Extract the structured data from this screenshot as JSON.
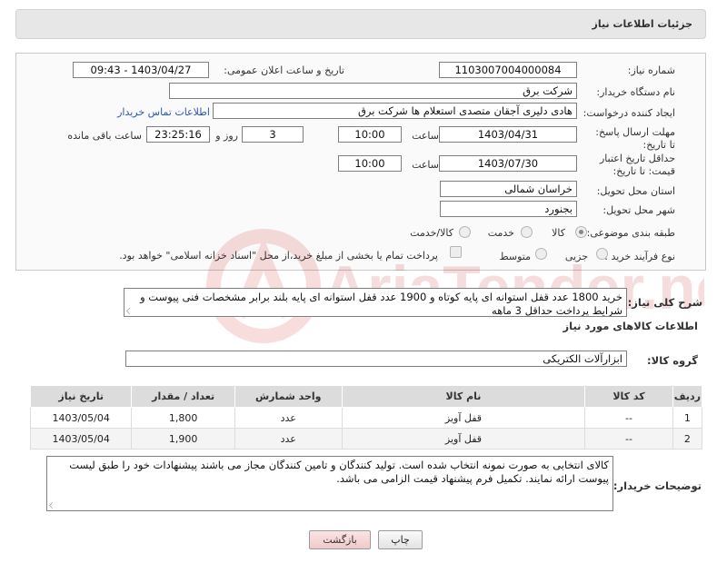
{
  "header": {
    "title": "جزئیات اطلاعات نیاز"
  },
  "form": {
    "need_number_label": "شماره نیاز:",
    "need_number": "1103007004000084",
    "announce_label": "تاریخ و ساعت اعلان عمومی:",
    "announce_value": "1403/04/27 - 09:43",
    "buyer_org_label": "نام دستگاه خریدار:",
    "buyer_org": "شرکت برق",
    "creator_label": "ایجاد کننده درخواست:",
    "creator": "هادی دلیری آجقان متصدی استعلام ها  شرکت برق",
    "contact_link": "اطلاعات تماس خریدار",
    "deadline_label": "مهلت ارسال پاسخ: تا تاریخ:",
    "deadline_date": "1403/04/31",
    "time_label": "ساعت",
    "deadline_time": "10:00",
    "days_value": "3",
    "days_label": "روز و",
    "remaining_time": "23:25:16",
    "remaining_label": "ساعت باقی مانده",
    "validity_label": "حداقل تاریخ اعتبار قیمت: تا تاریخ:",
    "validity_date": "1403/07/30",
    "validity_time": "10:00",
    "province_label": "استان محل تحویل:",
    "province": "خراسان شمالی",
    "city_label": "شهر محل تحویل:",
    "city": "بجنورد",
    "category_label": "طبقه بندی موضوعی:",
    "category_options": [
      "کالا",
      "خدمت",
      "کالا/خدمت"
    ],
    "process_label": "نوع فرآیند خرید :",
    "process_options": [
      "جزیی",
      "متوسط"
    ],
    "payment_note": "پرداخت تمام یا بخشی از مبلغ خرید،از محل \"اسناد خزانه اسلامی\" خواهد بود."
  },
  "description": {
    "label": "شرح کلی نیاز:",
    "text": "خرید 1800 عدد قفل استوانه ای پایه کوتاه و 1900 عدد قفل استوانه ای پایه بلند برابر مشخصات فنی پیوست و شرایط پرداخت حداقل 3 ماهه"
  },
  "goods": {
    "section_title": "اطلاعات کالاهای مورد نیاز",
    "group_label": "گروه کالا:",
    "group_value": "ابزارآلات الکتریکی",
    "columns": [
      "ردیف",
      "کد کالا",
      "نام کالا",
      "واحد شمارش",
      "تعداد / مقدار",
      "تاریخ نیاز"
    ],
    "rows": [
      {
        "idx": "1",
        "code": "--",
        "name": "قفل آویز",
        "unit": "عدد",
        "qty": "1,800",
        "date": "1403/05/04"
      },
      {
        "idx": "2",
        "code": "--",
        "name": "قفل آویز",
        "unit": "عدد",
        "qty": "1,900",
        "date": "1403/05/04"
      }
    ]
  },
  "buyer_notes": {
    "label": "توضیحات خریدار:",
    "text": "کالای انتخابی به صورت نمونه انتخاب شده است. تولید کنندگان و تامین کنندگان مجاز می باشند پیشنهادات خود را طبق لیست پیوست ارائه نمایند. تکمیل فرم پیشنهاد قیمت الزامی می باشد."
  },
  "buttons": {
    "print": "چاپ",
    "back": "بازگشت"
  },
  "watermark_text": "AriaTender.net"
}
